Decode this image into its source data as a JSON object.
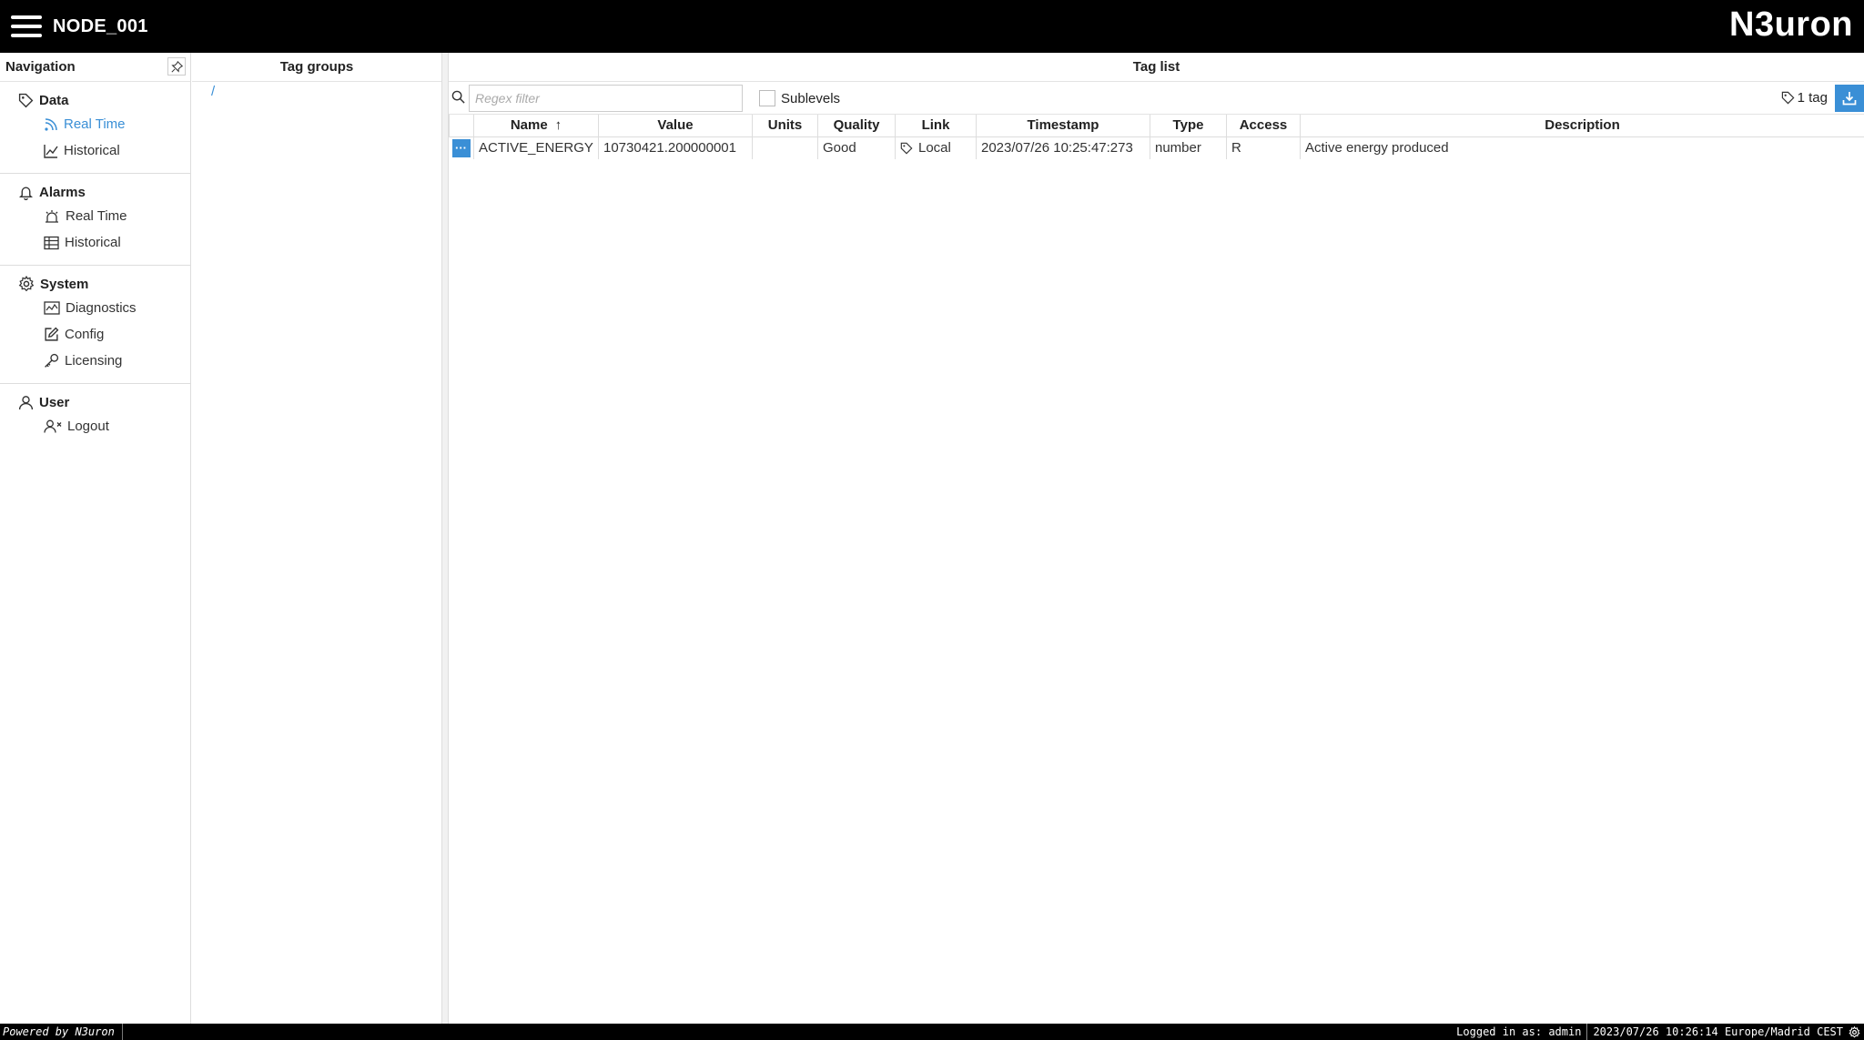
{
  "header": {
    "node_name": "NODE_001",
    "brand": "N3uron"
  },
  "navigation": {
    "title": "Navigation",
    "sections": [
      {
        "title": "Data",
        "icon": "tag-icon",
        "items": [
          {
            "label": "Real Time",
            "icon": "rss-icon",
            "active": true
          },
          {
            "label": "Historical",
            "icon": "line-chart-icon"
          }
        ]
      },
      {
        "title": "Alarms",
        "icon": "bell-icon",
        "items": [
          {
            "label": "Real Time",
            "icon": "alarm-light-icon"
          },
          {
            "label": "Historical",
            "icon": "table-icon"
          }
        ]
      },
      {
        "title": "System",
        "icon": "gear-icon",
        "items": [
          {
            "label": "Diagnostics",
            "icon": "diagnostics-icon"
          },
          {
            "label": "Config",
            "icon": "edit-icon"
          },
          {
            "label": "Licensing",
            "icon": "key-icon"
          }
        ]
      },
      {
        "title": "User",
        "icon": "user-icon",
        "items": [
          {
            "label": "Logout",
            "icon": "user-x-icon"
          }
        ]
      }
    ]
  },
  "tag_groups": {
    "title": "Tag groups",
    "root": "/"
  },
  "tag_list": {
    "title": "Tag list",
    "filter_placeholder": "Regex filter",
    "filter_value": "",
    "sublevels_label": "Sublevels",
    "sublevels_checked": false,
    "count_label": "1 tag",
    "columns": [
      "Name",
      "Value",
      "Units",
      "Quality",
      "Link",
      "Timestamp",
      "Type",
      "Access",
      "Description"
    ],
    "sort_indicator": "↑",
    "rows": [
      {
        "name": "ACTIVE_ENERGY",
        "value": "10730421.200000001",
        "units": "",
        "quality": "Good",
        "link": "Local",
        "timestamp": "2023/07/26 10:25:47:273",
        "type": "number",
        "access": "R",
        "description": "Active energy produced"
      }
    ]
  },
  "footer": {
    "powered": "Powered by N3uron",
    "logged_in": "Logged in as: admin",
    "datetime": "2023/07/26 10:26:14 Europe/Madrid CEST"
  },
  "colors": {
    "accent": "#3a8fd6",
    "header_bg": "#000000"
  }
}
